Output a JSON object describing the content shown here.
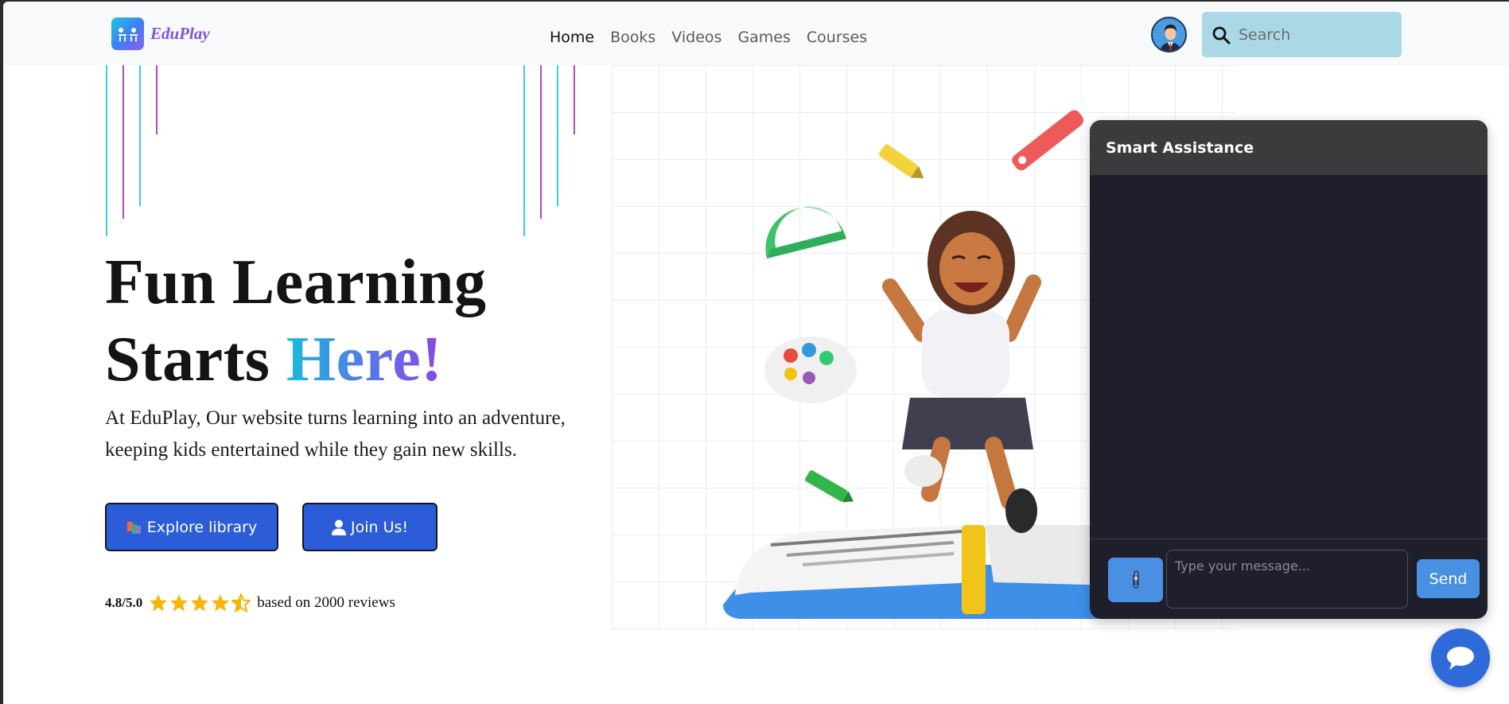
{
  "brand": {
    "name": "EduPlay"
  },
  "nav": {
    "items": [
      {
        "label": "Home",
        "active": true
      },
      {
        "label": "Books",
        "active": false
      },
      {
        "label": "Videos",
        "active": false
      },
      {
        "label": "Games",
        "active": false
      },
      {
        "label": "Courses",
        "active": false
      }
    ]
  },
  "search": {
    "placeholder": "Search",
    "value": ""
  },
  "hero": {
    "title_line1": "Fun Learning",
    "title_line2_plain": "Starts ",
    "title_line2_gradient": "Here!",
    "subtitle": "At EduPlay, Our website turns learning into an adventure, keeping kids entertained while they gain new skills.",
    "explore_button": "Explore library",
    "join_button": "Join Us!"
  },
  "rating": {
    "score": "4.8/5.0",
    "stars_value": 4.5,
    "stars_max": 5,
    "text": "based on 2000 reviews"
  },
  "chat": {
    "title": "Smart Assistance",
    "input_placeholder": "Type your message...",
    "send_label": "Send"
  },
  "colors": {
    "accent": "#2c5cd7",
    "chat_accent": "#4a90e2",
    "brand_purple": "#7a55e0",
    "star": "#f5b50a"
  },
  "icons": {
    "brand": "eduplay-logo-icon",
    "search": "search-icon",
    "explore": "books-icon",
    "join": "user-icon",
    "attach": "paperclip-icon",
    "fab": "chat-bubble-icon"
  }
}
